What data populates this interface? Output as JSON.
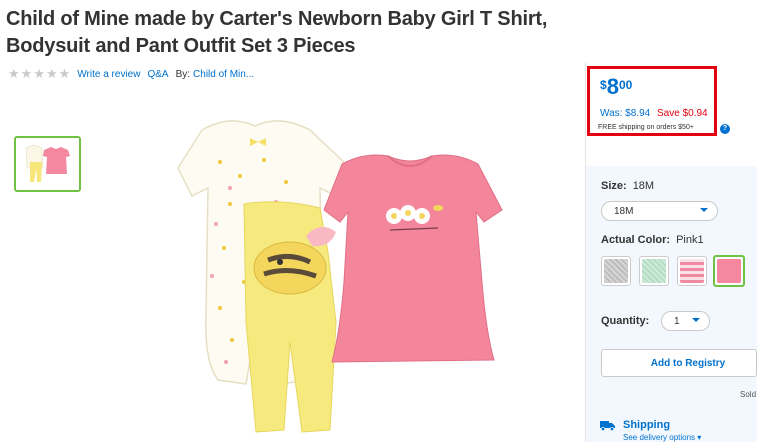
{
  "product": {
    "title": "Child of Mine made by Carter's Newborn Baby Girl T Shirt, Bodysuit and Pant Outfit Set 3 Pieces",
    "rating_stars": 0,
    "write_review": "Write a review",
    "qa": "Q&A",
    "by_label": "By:",
    "brand": "Child of Min..."
  },
  "price": {
    "currency": "$",
    "dollars": "8",
    "cents": "00",
    "was": "Was: $8.94",
    "save": "Save $0.94",
    "shipping_note": "FREE shipping on orders $50+",
    "help_icon": "?"
  },
  "options": {
    "size_label": "Size:",
    "size_value": "18M",
    "size_select": "18M",
    "color_label": "Actual Color:",
    "color_value": "Pink1",
    "swatches": [
      {
        "name": "gray-heather",
        "color": "#c7c7c7"
      },
      {
        "name": "mint",
        "color": "#bfe3cd"
      },
      {
        "name": "pink-stripe",
        "color": "#f2a6b6"
      },
      {
        "name": "pink",
        "color": "#f4889e",
        "selected": true
      }
    ],
    "quantity_label": "Quantity:",
    "quantity_value": "1"
  },
  "actions": {
    "add_registry": "Add to Registry",
    "sold_label": "Sold"
  },
  "shipping": {
    "title": "Shipping",
    "sub": "See delivery options"
  },
  "colors": {
    "accent": "#0071ce",
    "highlight_border": "#e4000f",
    "selected_border": "#6fc244",
    "save_red": "#e4000f"
  }
}
